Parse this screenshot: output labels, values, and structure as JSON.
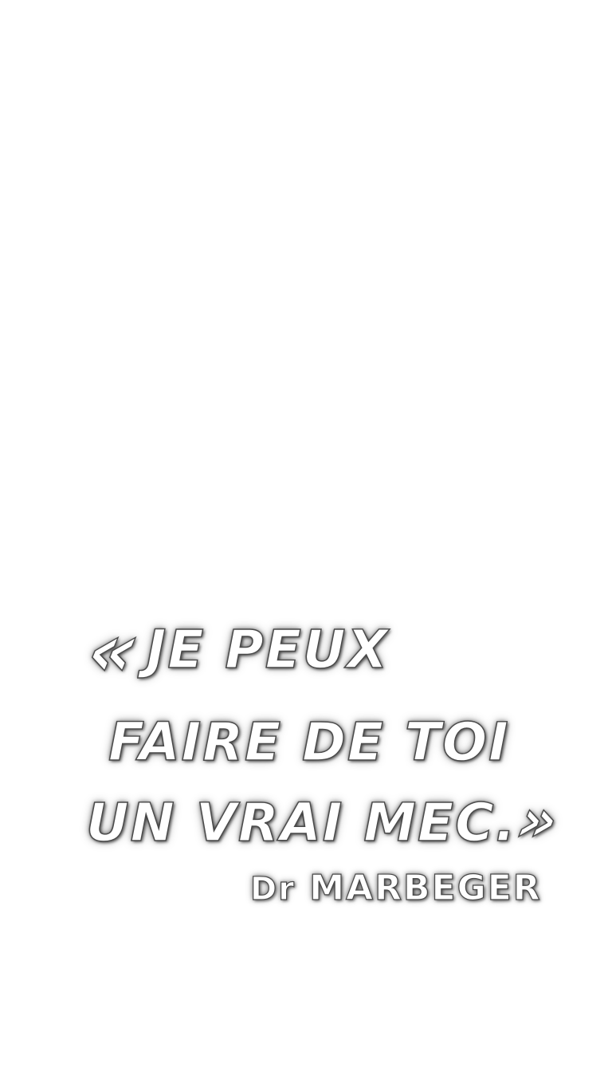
{
  "quote": {
    "open_mark": "«",
    "line1": "JE PEUX",
    "line2": "FAIRE DE TOI",
    "line3": "UN VRAI MEC.",
    "close_mark": "»"
  },
  "signature": {
    "title": "Dr",
    "name": "MARBEGER"
  },
  "colors": {
    "background": "#ffffff",
    "text_fill": "#ffffff",
    "text_outline": "#4a4a4a"
  }
}
